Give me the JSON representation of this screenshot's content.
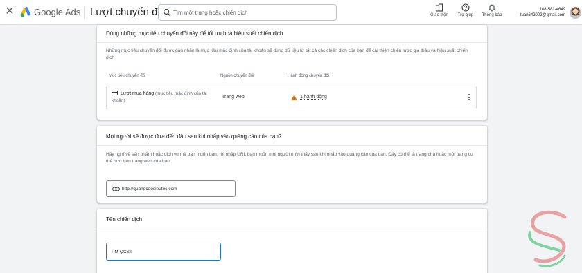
{
  "header": {
    "app_name": "Google Ads",
    "page_title": "Lượt chuyển đổi",
    "search_placeholder": "Tìm một trang hoặc chiến dịch",
    "tools": [
      {
        "label": "Giao diện",
        "icon": "appearance-icon"
      },
      {
        "label": "Trợ giúp",
        "icon": "help-icon"
      },
      {
        "label": "Thông báo",
        "icon": "bell-icon"
      }
    ],
    "account_id": "108-581-4649",
    "account_email": "tuan642002@gmail.com"
  },
  "goals_card": {
    "title": "Dùng những mục tiêu chuyển đổi này để tối ưu hoá hiệu suất chiến dịch",
    "description": "Những mục tiêu chuyển đổi được gắn nhãn là mục tiêu mặc định của tài khoản sẽ dùng dữ liệu từ tất cả các chiến dịch của bạn để cải thiện chiến lược giá thầu và hiệu suất chiến dịch",
    "columns": [
      "Mục tiêu chuyển đổi",
      "Nguồn chuyển đổi",
      "Hành động chuyển đổi"
    ],
    "row": {
      "goal_name": "Lượt mua hàng",
      "goal_note": "(mục tiêu mặc định của tài khoản)",
      "source": "Trang web",
      "action": "1 hành động"
    }
  },
  "url_card": {
    "title": "Mọi người sẽ được đưa đến đâu sau khi nhấp vào quảng cáo của bạn?",
    "description": "Hãy nghĩ về sản phẩm hoặc dịch vụ mà bạn muốn bán, rồi nhập URL bạn muốn mọi người nhìn thấy sau khi nhấp vào quảng cáo của bạn. Đây có thể là trang chủ hoặc một trang cụ thể hơn trên trang web của bạn.",
    "url_value": "http://quangcaosieutoc.com"
  },
  "name_card": {
    "title": "Tên chiến dịch",
    "name_value": "PM-QCST"
  },
  "colors": {
    "primary_blue": "#1a73e8",
    "warning": "#e37400",
    "logo_yellow": "#fbbc04",
    "logo_blue": "#4285f4",
    "logo_green": "#34a853"
  }
}
